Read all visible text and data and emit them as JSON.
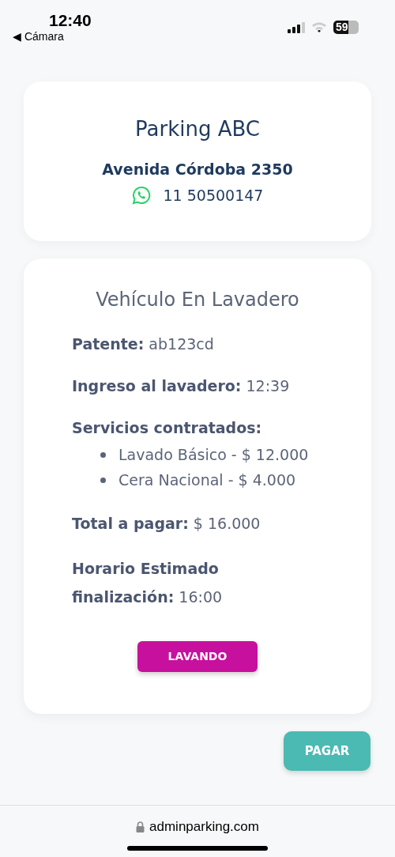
{
  "status_bar": {
    "time": "12:40",
    "back_label": "◀ Cámara",
    "battery": "59"
  },
  "business": {
    "name": "Parking ABC",
    "address": "Avenida Córdoba 2350",
    "phone": "11 50500147"
  },
  "vehicle": {
    "title": "Vehículo En Lavadero",
    "fields": [
      {
        "kind": "inline",
        "label": "Patente:",
        "value": "ab123cd"
      },
      {
        "kind": "inline",
        "label": "Ingreso al lavadero:",
        "value": "12:39"
      },
      {
        "kind": "list",
        "label": "Servicios contratados:",
        "items": [
          "Lavado Básico - $ 12.000",
          "Cera Nacional - $ 4.000"
        ]
      },
      {
        "kind": "inline",
        "label": "Total a pagar:",
        "value": "$ 16.000"
      },
      {
        "kind": "block",
        "label": "Horario Estimado finalización:",
        "value": "16:00"
      }
    ],
    "status_button": "LAVANDO"
  },
  "pay_button": "PAGAR",
  "browser": {
    "url": "adminparking.com"
  }
}
